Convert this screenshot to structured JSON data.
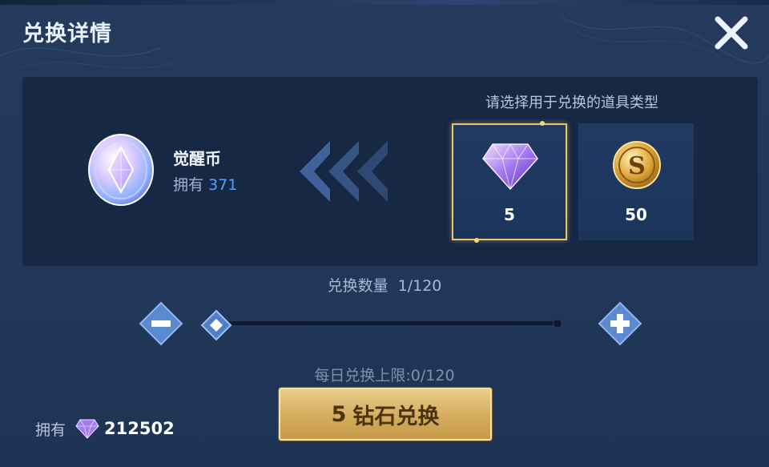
{
  "dialog": {
    "title": "兑换详情"
  },
  "target_item": {
    "name": "觉醒币",
    "own_label": "拥有",
    "own_count": "371"
  },
  "currency_select": {
    "hint": "请选择用于兑换的道具类型",
    "options": [
      {
        "icon": "diamond-icon",
        "value": "5",
        "selected": true
      },
      {
        "icon": "gold-coin-icon",
        "value": "50",
        "selected": false
      }
    ]
  },
  "quantity": {
    "label": "兑换数量",
    "value": "1/120",
    "current": 1,
    "max": 120
  },
  "daily_limit": "每日兑换上限:0/120",
  "owned": {
    "label": "拥有",
    "icon": "diamond-icon",
    "amount": "212502"
  },
  "confirm_button": {
    "amount": "5",
    "label": "钻石兑换"
  },
  "colors": {
    "background": "#22385a",
    "panel": "#172845",
    "accent_blue": "#4fa3ff",
    "gold": "#e9c56b"
  }
}
